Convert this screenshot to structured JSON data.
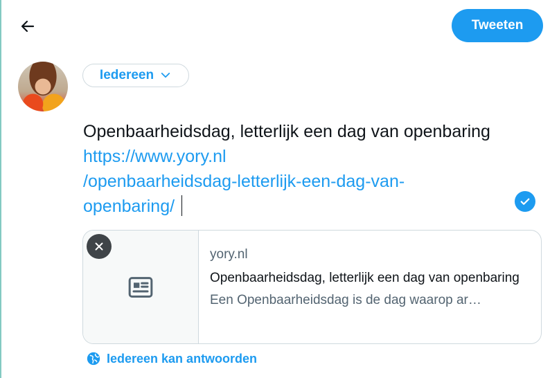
{
  "header": {
    "back_icon": "arrow-left-icon",
    "tweet_label": "Tweeten"
  },
  "composer": {
    "audience_label": "Iedereen",
    "text_plain": "Openbaarheidsdag, letterlijk een dag van openbaring ",
    "text_link": "https://www.yory.nl/openbaarheidsdag-letterlijk-een-dag-van-openbaring/",
    "text_link_line1": "https://www.yory.nl",
    "text_link_line2": "/openbaarheidsdag-letterlijk-een-dag-van-",
    "text_link_line3": "openbaring/"
  },
  "link_card": {
    "domain": "yory.nl",
    "title": "Openbaarheidsdag, letterlijk een dag van openbaring",
    "description": "Een Openbaarheidsdag is de dag waarop ar…",
    "thumb_icon": "article-icon",
    "close_icon": "close-icon"
  },
  "reply_setting": {
    "icon": "globe-icon",
    "label": "Iedereen kan antwoorden"
  },
  "colors": {
    "accent": "#1d9bf0",
    "text": "#0f1419",
    "muted": "#536471",
    "border": "#cfd9de"
  }
}
